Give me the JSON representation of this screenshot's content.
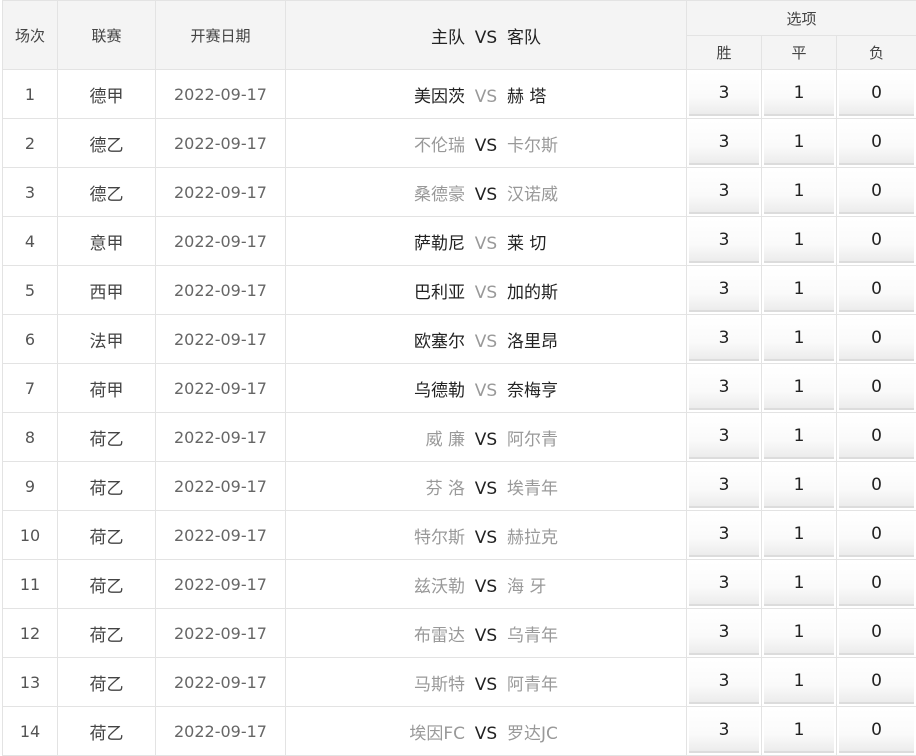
{
  "headers": {
    "index": "场次",
    "league": "联赛",
    "date": "开赛日期",
    "home": "主队",
    "vs": "VS",
    "away": "客队",
    "options": "选项",
    "win": "胜",
    "draw": "平",
    "lose": "负"
  },
  "rows": [
    {
      "index": "1",
      "league": "德甲",
      "date": "2022-09-17",
      "home": "美因茨",
      "vs": "VS",
      "away": "赫 塔",
      "win": "3",
      "draw": "1",
      "lose": "0"
    },
    {
      "index": "2",
      "league": "德乙",
      "date": "2022-09-17",
      "home": "不伦瑞",
      "vs": "VS",
      "away": "卡尔斯",
      "win": "3",
      "draw": "1",
      "lose": "0"
    },
    {
      "index": "3",
      "league": "德乙",
      "date": "2022-09-17",
      "home": "桑德豪",
      "vs": "VS",
      "away": "汉诺威",
      "win": "3",
      "draw": "1",
      "lose": "0"
    },
    {
      "index": "4",
      "league": "意甲",
      "date": "2022-09-17",
      "home": "萨勒尼",
      "vs": "VS",
      "away": "莱 切",
      "win": "3",
      "draw": "1",
      "lose": "0"
    },
    {
      "index": "5",
      "league": "西甲",
      "date": "2022-09-17",
      "home": "巴利亚",
      "vs": "VS",
      "away": "加的斯",
      "win": "3",
      "draw": "1",
      "lose": "0"
    },
    {
      "index": "6",
      "league": "法甲",
      "date": "2022-09-17",
      "home": "欧塞尔",
      "vs": "VS",
      "away": "洛里昂",
      "win": "3",
      "draw": "1",
      "lose": "0"
    },
    {
      "index": "7",
      "league": "荷甲",
      "date": "2022-09-17",
      "home": "乌德勒",
      "vs": "VS",
      "away": "奈梅亨",
      "win": "3",
      "draw": "1",
      "lose": "0"
    },
    {
      "index": "8",
      "league": "荷乙",
      "date": "2022-09-17",
      "home": "威 廉",
      "vs": "VS",
      "away": "阿尔青",
      "win": "3",
      "draw": "1",
      "lose": "0"
    },
    {
      "index": "9",
      "league": "荷乙",
      "date": "2022-09-17",
      "home": "芬 洛",
      "vs": "VS",
      "away": "埃青年",
      "win": "3",
      "draw": "1",
      "lose": "0"
    },
    {
      "index": "10",
      "league": "荷乙",
      "date": "2022-09-17",
      "home": "特尔斯",
      "vs": "VS",
      "away": "赫拉克",
      "win": "3",
      "draw": "1",
      "lose": "0"
    },
    {
      "index": "11",
      "league": "荷乙",
      "date": "2022-09-17",
      "home": "兹沃勒",
      "vs": "VS",
      "away": "海 牙",
      "win": "3",
      "draw": "1",
      "lose": "0"
    },
    {
      "index": "12",
      "league": "荷乙",
      "date": "2022-09-17",
      "home": "布雷达",
      "vs": "VS",
      "away": "乌青年",
      "win": "3",
      "draw": "1",
      "lose": "0"
    },
    {
      "index": "13",
      "league": "荷乙",
      "date": "2022-09-17",
      "home": "马斯特",
      "vs": "VS",
      "away": "阿青年",
      "win": "3",
      "draw": "1",
      "lose": "0"
    },
    {
      "index": "14",
      "league": "荷乙",
      "date": "2022-09-17",
      "home": "埃因FC",
      "vs": "VS",
      "away": "罗达JC",
      "win": "3",
      "draw": "1",
      "lose": "0"
    }
  ],
  "colors": {
    "header_bg": "#f4f4f4",
    "border": "#e3e3e3",
    "text_dark": "#222222",
    "text_muted": "#999999"
  }
}
